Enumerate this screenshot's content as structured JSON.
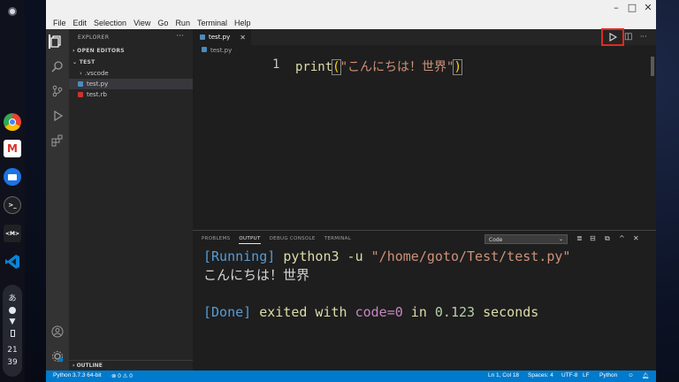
{
  "desktop": {
    "shelf_apps": [
      {
        "icon": "chrome-icon",
        "color": "#e34133"
      },
      {
        "icon": "gmail-icon",
        "color": "#d93025"
      },
      {
        "icon": "files-icon",
        "color": "#1a73e8"
      },
      {
        "icon": "terminal-icon",
        "label": ">_",
        "color": "#202124"
      },
      {
        "icon": "crosh-icon",
        "label": "<M>",
        "color": "#202124"
      },
      {
        "icon": "vscode-icon",
        "color": "#0078d4"
      }
    ],
    "clock": {
      "hour": "21",
      "minute": "39"
    },
    "ime": "あ"
  },
  "window": {
    "menu": [
      "File",
      "Edit",
      "Selection",
      "View",
      "Go",
      "Run",
      "Terminal",
      "Help"
    ],
    "controls": {
      "minimize": "–",
      "maximize": "□",
      "close": "✕"
    }
  },
  "sidebar": {
    "title": "EXPLORER",
    "more": "···",
    "open_editors": "OPEN EDITORS",
    "folder": "TEST",
    "items": [
      {
        "label": ".vscode",
        "kind": "folder"
      },
      {
        "label": "test.py",
        "kind": "python",
        "selected": true
      },
      {
        "label": "test.rb",
        "kind": "ruby"
      }
    ],
    "outline": "OUTLINE"
  },
  "editor": {
    "tab_label": "test.py",
    "tab_close": "✕",
    "breadcrumb": "test.py",
    "line_number": "1",
    "code": {
      "fn": "print",
      "open": "(",
      "string": "\"こんにちは！世界\"",
      "close": ")"
    },
    "accent_run_highlight": "#e02b1c"
  },
  "panel": {
    "tabs": [
      "PROBLEMS",
      "OUTPUT",
      "DEBUG CONSOLE",
      "TERMINAL"
    ],
    "active_tab": "OUTPUT",
    "channel": "Code",
    "output": {
      "running_tag": "[Running]",
      "command": "python3 -u ",
      "path": "\"/home/goto/Test/test.py\"",
      "result": "こんにちは！世界",
      "done_tag": "[Done]",
      "exited": "exited with ",
      "code_label": "code=0",
      "in": " in ",
      "time": "0.123",
      "seconds": " seconds"
    }
  },
  "statusbar": {
    "interpreter": "Python 3.7.3 64-bit",
    "problems": "⊗ 0 ⚠ 0",
    "position": "Ln 1, Col 18",
    "spaces": "Spaces: 4",
    "encoding": "UTF-8",
    "eol": "LF",
    "language": "Python",
    "color": "#007acc"
  }
}
